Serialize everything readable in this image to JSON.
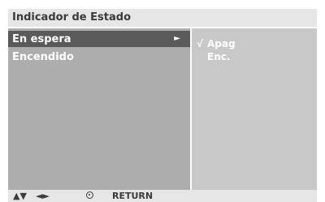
{
  "title": "Indicador de Estado",
  "menu": {
    "items": [
      {
        "label": "En espera",
        "selected": true,
        "submenu_arrow": "►"
      },
      {
        "label": "Encendido",
        "selected": false
      }
    ]
  },
  "options": {
    "check_mark": "√",
    "items": [
      {
        "label": "Apag",
        "checked": true
      },
      {
        "label": "Enc.",
        "checked": false
      }
    ]
  },
  "footer": {
    "updown_icon": "▲▼",
    "leftright_icon": "◄►",
    "ok_icon": "ok-button-icon",
    "return_label": "RETURN"
  },
  "colors": {
    "title_bar": "#e6e6e6",
    "left_panel": "#adadad",
    "selected_item": "#5a5a5a",
    "right_panel": "#c8c8c8",
    "text_light": "#ffffff",
    "text_dark": "#3a3a3a"
  }
}
